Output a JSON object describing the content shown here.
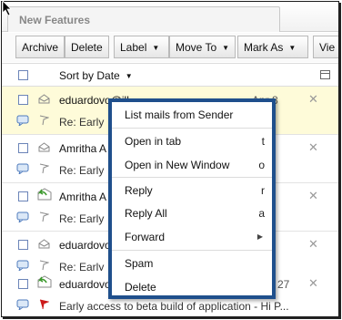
{
  "tab": {
    "title": "New Features"
  },
  "toolbar": {
    "archive": "Archive",
    "delete": "Delete",
    "label": "Label",
    "move_to": "Move To",
    "mark_as": "Mark As",
    "view": "Vie"
  },
  "list": {
    "sort_label": "Sort by Date",
    "rows": [
      {
        "sender": "eduardovo@ill...",
        "subject": "Re: Early",
        "date": "Apr 8",
        "selected": true
      },
      {
        "sender": "Amritha A",
        "subject": "Re: Early",
        "date": ""
      },
      {
        "sender": "Amritha A",
        "subject": "Re: Early",
        "date": ""
      },
      {
        "sender": "eduardovo",
        "subject": "Re: Early",
        "date": ""
      },
      {
        "sender": "eduardovo",
        "subject": "Early access to beta build of application - Hi P...",
        "date": "27"
      }
    ]
  },
  "context_menu": {
    "items": [
      {
        "label": "List mails from Sender",
        "key": ""
      },
      {
        "label": "Open in tab",
        "key": "t"
      },
      {
        "label": "Open in New Window",
        "key": "o"
      },
      {
        "label": "Reply",
        "key": "r"
      },
      {
        "label": "Reply All",
        "key": "a"
      },
      {
        "label": "Forward",
        "key": ""
      },
      {
        "label": "Spam",
        "key": ""
      },
      {
        "label": "Delete",
        "key": ""
      }
    ]
  },
  "colors": {
    "menu_border": "#1f4f8c",
    "selected_row": "#fefbd9",
    "flag": "#cc1a1a",
    "reply_arrow": "#3d9a2e"
  },
  "icons": [
    "envelope-icon",
    "reply-icon",
    "flag-icon",
    "chat-icon",
    "close-icon",
    "columns-icon",
    "caret-icon",
    "cursor-icon"
  ]
}
